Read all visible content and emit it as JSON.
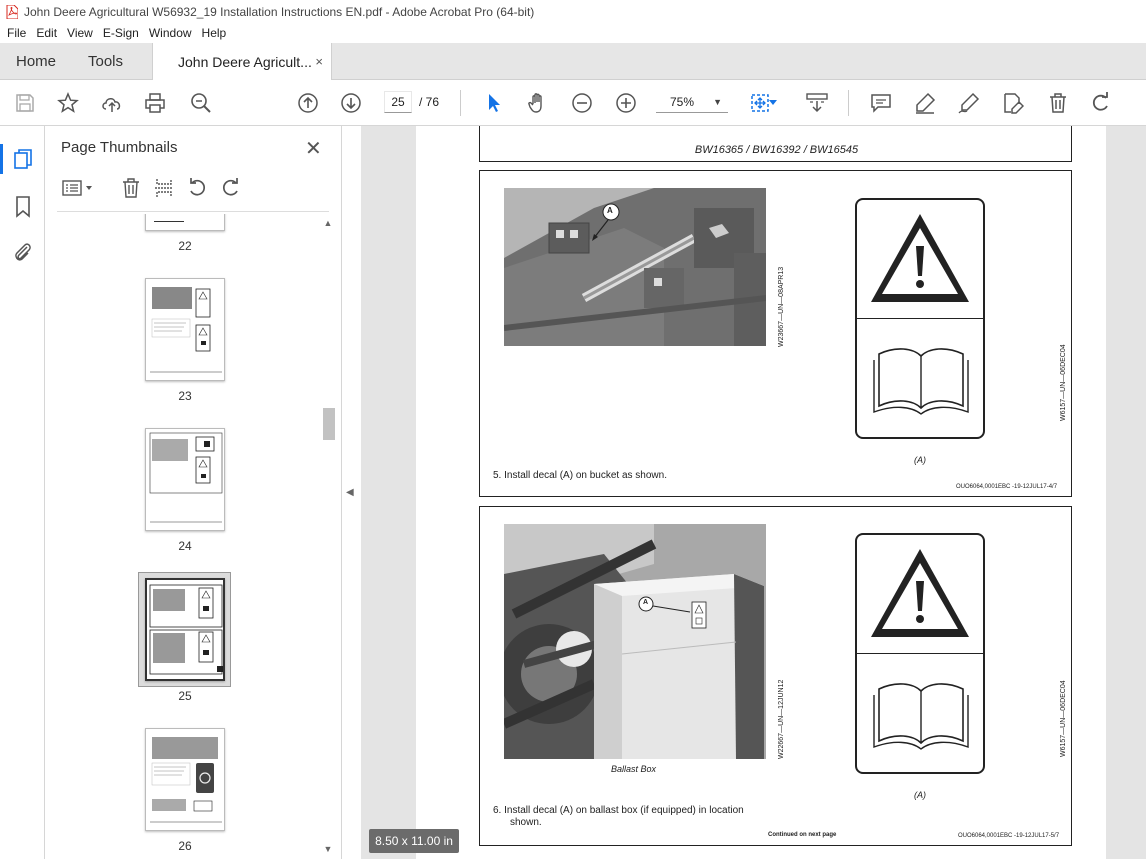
{
  "window": {
    "title": "John Deere Agricultural W56932_19 Installation Instructions EN.pdf - Adobe Acrobat Pro (64-bit)"
  },
  "menu": [
    "File",
    "Edit",
    "View",
    "E-Sign",
    "Window",
    "Help"
  ],
  "tabs": {
    "home": "Home",
    "tools": "Tools",
    "document": "John Deere Agricult...",
    "close_symbol": "×"
  },
  "toolbar": {
    "current_page": "25",
    "page_total": "/ 76",
    "zoom": "75%"
  },
  "thumbnails_panel": {
    "title": "Page Thumbnails",
    "pages": [
      "22",
      "23",
      "24",
      "25",
      "26"
    ],
    "selected_page": "25"
  },
  "document": {
    "header": "BW16365 / BW16392 / BW16545",
    "section1": {
      "callout": "A",
      "photo_code": "W23667—UN—08APR13",
      "decal_code": "W6157—UN—06DEC04",
      "decal_caption": "(A)",
      "step": "5.   Install decal (A) on bucket as shown.",
      "ref": "OUO6064,0001EBC -19-12JUL17-4/7"
    },
    "section2": {
      "callout": "A",
      "photo_code": "W22667—UN—12JUN12",
      "photo_caption": "Ballast Box",
      "decal_code": "W6157—UN—06DEC04",
      "decal_caption": "(A)",
      "step_line1": "6.   Install decal (A) on ballast box (if equipped) in location",
      "step_line2": "shown.",
      "continued": "Continued on next page",
      "ref": "OUO6064,0001EBC -19-12JUL17-5/7"
    }
  },
  "status": {
    "page_size": "8.50 x 11.00 in"
  },
  "colors": {
    "accent": "#1473e6",
    "pdf_red": "#d7271e",
    "tab_bar": "#e6e6e6",
    "doc_background": "#e4e4e4"
  }
}
